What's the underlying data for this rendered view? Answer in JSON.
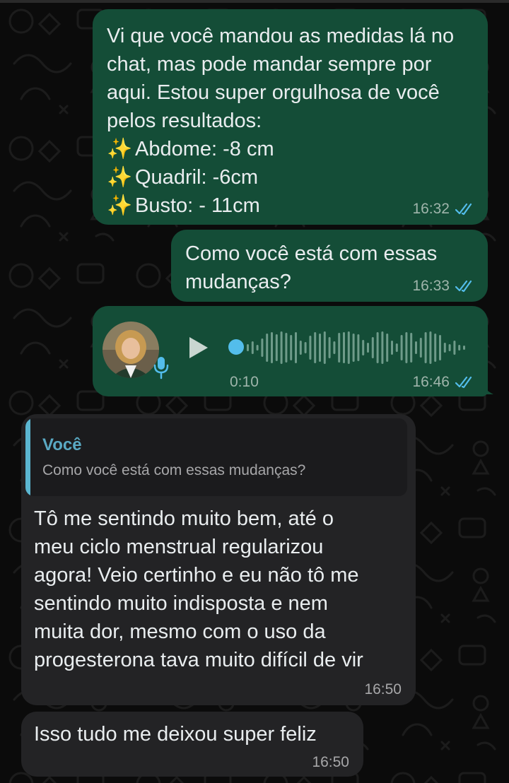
{
  "messages": {
    "m1": {
      "intro": "Vi que você mandou as medidas lá no chat, mas pode mandar sempre por aqui. Estou super orgulhosa de você pelos resultados:",
      "list": [
        {
          "icon": "sparkles-icon",
          "glyph": "✨",
          "text": "Abdome: -8 cm"
        },
        {
          "icon": "sparkles-icon",
          "glyph": "✨",
          "text": "Quadril: -6cm"
        },
        {
          "icon": "sparkles-icon",
          "glyph": "✨",
          "text": "Busto: - 11cm"
        }
      ],
      "time": "16:32"
    },
    "m2": {
      "text": "Como você está com essas\nmudanças?",
      "time": "16:33"
    },
    "m3": {
      "duration": "0:10",
      "time": "16:46"
    },
    "m4": {
      "quote_name": "Você",
      "quote_text": "Como você está com essas mudanças?",
      "text": "Tô me sentindo muito bem, até o\nmeu ciclo menstrual regularizou\nagora! Veio certinho e eu não tô me\nsentindo muito indisposta e nem\nmuita dor, mesmo com o uso da\nprogesterona tava muito difícil de vir",
      "time": "16:50"
    },
    "m5": {
      "text": "Isso tudo me deixou super feliz",
      "time": "16:50"
    }
  },
  "colors": {
    "outgoing_bubble": "#144d37",
    "incoming_bubble": "#232325",
    "read_ticks": "#53bdeb",
    "quote_accent": "#5bb6d1"
  }
}
